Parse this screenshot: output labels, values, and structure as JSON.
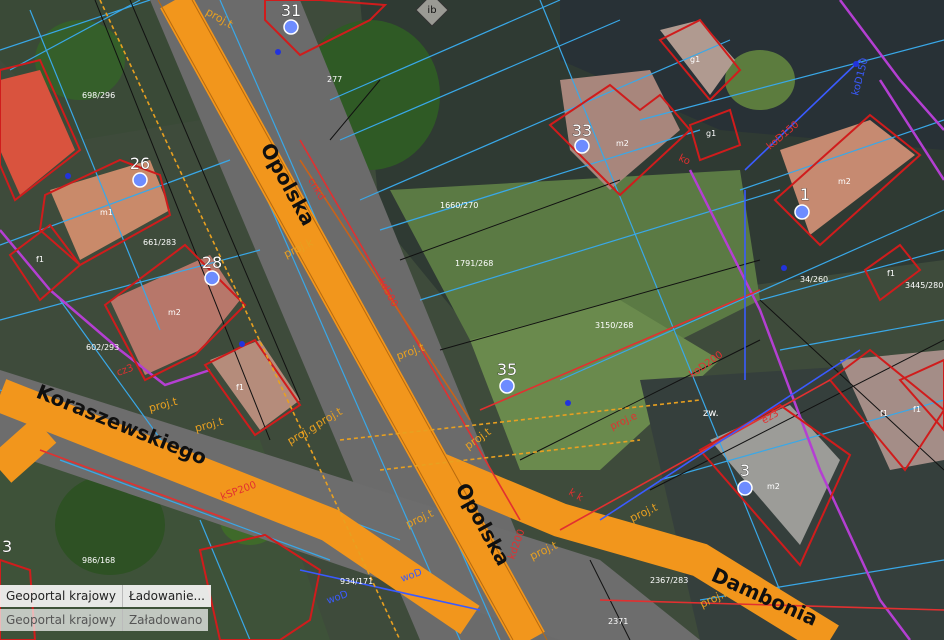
{
  "map": {
    "streets": {
      "opolska_upper": "Opolska",
      "opolska_lower": "Opolska",
      "koraszewskiego": "Koraszewskiego",
      "dambonia": "Dambonia"
    },
    "building_numbers": {
      "n31": "31",
      "n33": "33",
      "n26": "26",
      "n1": "1",
      "n28": "28",
      "n35": "35",
      "n3": "3",
      "n3b": "3"
    },
    "badge": "ib",
    "parcels": {
      "p277": "277",
      "p1660_270": "1660/270",
      "p1791_268": "1791/268",
      "p3150_268": "3150/268",
      "p698_296": "698/296",
      "p661_283": "661/283",
      "p602_293": "602/293",
      "p986_168": "986/168",
      "p2367_283": "2367/283",
      "p34_260": "34/260",
      "p3445_280": "3445/280",
      "p934_171": "934/171",
      "p2371": "2371"
    },
    "building_codes": {
      "m1": "m1",
      "m2": "m2",
      "f1": "f1",
      "g1": "g1",
      "zw": "zw."
    },
    "utilities": {
      "projt": "proj.t",
      "projg": "proj.g",
      "projk": "proj.k",
      "proje": "proj.e",
      "cnkd": "cnkd",
      "kd500": "kd500",
      "kod150": "koD150",
      "kod200": "koD200",
      "kd200": "kd200",
      "ksp200": "kSP200",
      "wod": "woD",
      "ko": "ko",
      "kk": "k k",
      "ez": "ez3",
      "cz": "cz3"
    }
  },
  "status_bar": {
    "row1": {
      "source": "Geoportal krajowy",
      "state": "Ładowanie..."
    },
    "row2": {
      "source": "Geoportal krajowy",
      "state": "Załadowano"
    }
  }
}
